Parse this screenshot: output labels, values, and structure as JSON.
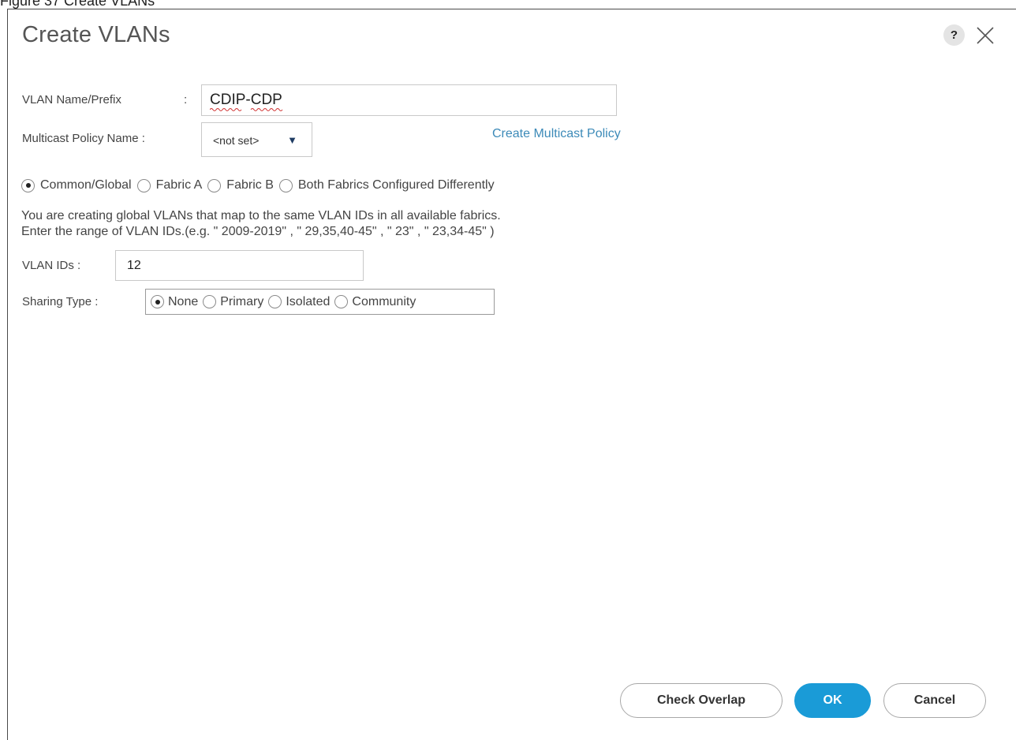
{
  "figure_caption": "Figure 37 Create VLANs",
  "dialog": {
    "title": "Create VLANs",
    "help_label": "?",
    "close_icon": "close-icon"
  },
  "form": {
    "vlan_name_label": "VLAN Name/Prefix",
    "vlan_name_sep": ":",
    "vlan_name_value": "CDIP-CDP",
    "multicast_label": "Multicast Policy Name :",
    "multicast_selected": "<not set>",
    "multicast_arrow": "▼",
    "create_multicast_link": "Create Multicast Policy",
    "fabric_options": [
      {
        "label": "Common/Global",
        "checked": true
      },
      {
        "label": "Fabric A",
        "checked": false
      },
      {
        "label": "Fabric B",
        "checked": false
      },
      {
        "label": "Both Fabrics Configured Differently",
        "checked": false
      }
    ],
    "message_line1": "You are creating global VLANs that map to the same VLAN IDs in all available fabrics.",
    "message_line2": "Enter the range of VLAN IDs.(e.g. \" 2009-2019\" , \" 29,35,40-45\" , \" 23\" , \" 23,34-45\" )",
    "vlan_ids_label": "VLAN IDs :",
    "vlan_ids_value": "12",
    "sharing_type_label": "Sharing Type :",
    "sharing_options": [
      {
        "label": "None",
        "checked": true
      },
      {
        "label": "Primary",
        "checked": false
      },
      {
        "label": "Isolated",
        "checked": false
      },
      {
        "label": "Community",
        "checked": false
      }
    ]
  },
  "buttons": {
    "check_overlap": "Check Overlap",
    "ok": "OK",
    "cancel": "Cancel"
  },
  "colors": {
    "accent": "#1a9bd7",
    "link": "#3c8ab8"
  }
}
